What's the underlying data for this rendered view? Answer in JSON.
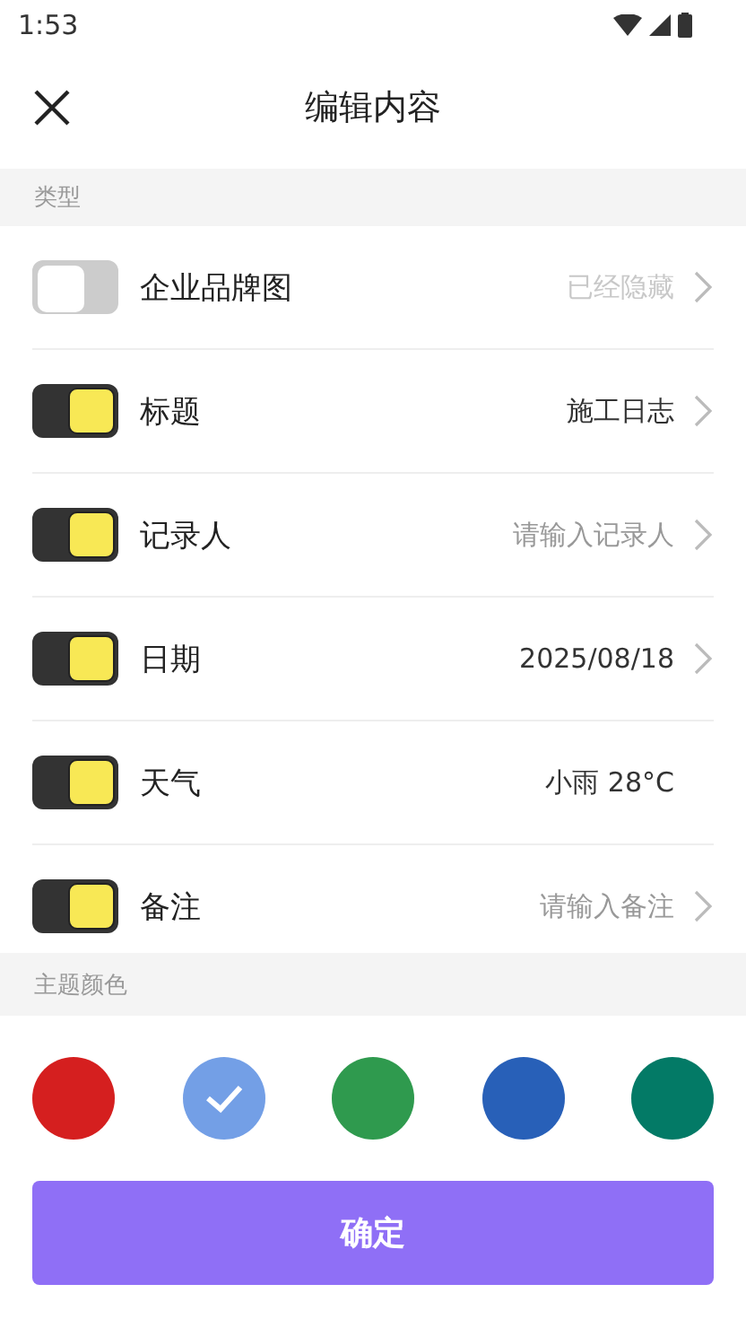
{
  "status_bar": {
    "time": "1:53"
  },
  "header": {
    "title": "编辑内容"
  },
  "sections": [
    {
      "title": "类型"
    },
    {
      "title": "主题颜色"
    }
  ],
  "rows": [
    {
      "label": "企业品牌图",
      "on": false,
      "value": "已经隐藏",
      "chevron": true
    },
    {
      "label": "标题",
      "on": true,
      "value": "施工日志",
      "chevron": true
    },
    {
      "label": "记录人",
      "on": true,
      "placeholder": "请输入记录人",
      "chevron": true
    },
    {
      "label": "日期",
      "on": true,
      "value": "2025/08/18",
      "chevron": true
    },
    {
      "label": "天气",
      "on": true,
      "value": "小雨 28°C",
      "chevron": false
    },
    {
      "label": "备注",
      "on": true,
      "placeholder": "请输入备注",
      "chevron": true
    }
  ],
  "colors": [
    {
      "color": "#d51f1f",
      "selected": false
    },
    {
      "color": "#739fe6",
      "selected": true
    },
    {
      "color": "#2f9a4e",
      "selected": false
    },
    {
      "color": "#2860b8",
      "selected": false
    },
    {
      "color": "#037a66",
      "selected": false
    }
  ],
  "confirm_button": "确定"
}
